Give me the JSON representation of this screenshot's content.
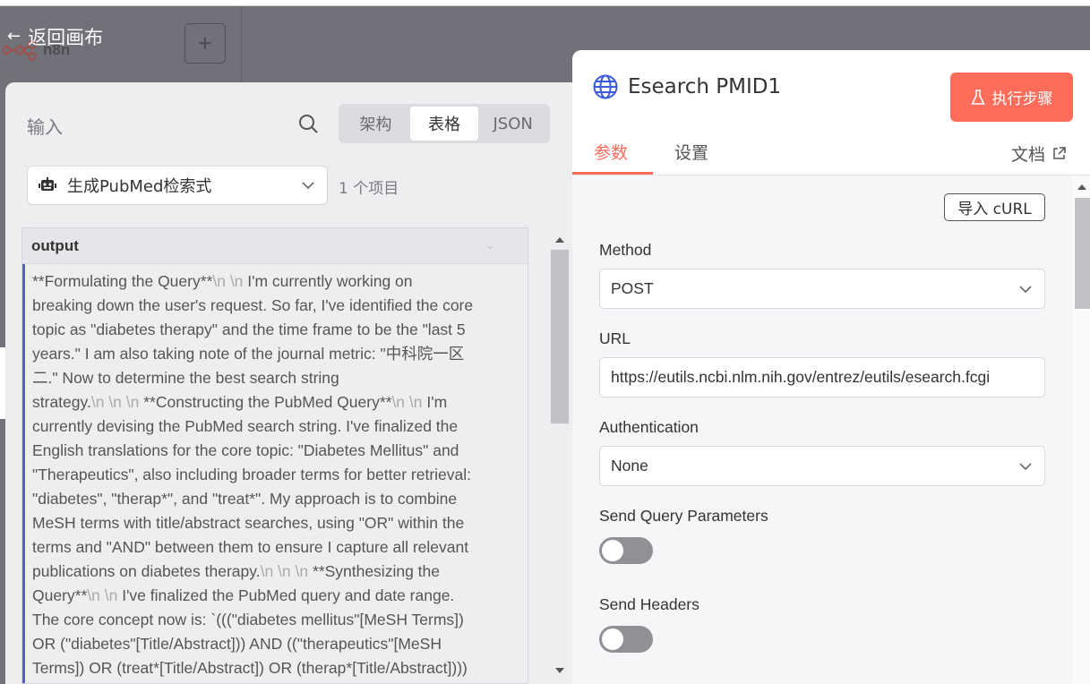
{
  "canvas": {
    "back_label": "返回画布",
    "logo_text": "n8n",
    "add_label": "+"
  },
  "input_panel": {
    "title": "输入",
    "view_tabs": [
      "架构",
      "表格",
      "JSON"
    ],
    "active_view": "表格",
    "source_node": "生成PubMed检索式",
    "item_count": "1 个项目",
    "table": {
      "column": "output",
      "cell_lines": [
        [
          {
            "t": "**Formulating the Query**"
          },
          {
            "t": "\\n \\n ",
            "nl": true
          },
          {
            "t": "I'm currently working on"
          }
        ],
        [
          {
            "t": "breaking down the user's request. So far, I've identified the core"
          }
        ],
        [
          {
            "t": "topic as \"diabetes therapy\" and the time frame to be the \"last 5"
          }
        ],
        [
          {
            "t": "years.\" I am also taking note of the journal metric: \"中科院一区"
          }
        ],
        [
          {
            "t": "二.\" Now to determine the best search string"
          }
        ],
        [
          {
            "t": "strategy."
          },
          {
            "t": "\\n \\n \\n ",
            "nl": true
          },
          {
            "t": "**Constructing the PubMed Query**"
          },
          {
            "t": "\\n \\n ",
            "nl": true
          },
          {
            "t": "I'm"
          }
        ],
        [
          {
            "t": "currently devising the PubMed search string. I've finalized the"
          }
        ],
        [
          {
            "t": "English translations for the core topic: \"Diabetes Mellitus\" and"
          }
        ],
        [
          {
            "t": "\"Therapeutics\", also including broader terms for better retrieval:"
          }
        ],
        [
          {
            "t": "\"diabetes\", \"therap*\", and \"treat*\". My approach is to combine"
          }
        ],
        [
          {
            "t": "MeSH terms with title/abstract searches, using \"OR\" within the"
          }
        ],
        [
          {
            "t": "terms and \"AND\" between them to ensure I capture all relevant"
          }
        ],
        [
          {
            "t": "publications on diabetes therapy."
          },
          {
            "t": "\\n \\n \\n ",
            "nl": true
          },
          {
            "t": "**Synthesizing the"
          }
        ],
        [
          {
            "t": "Query**"
          },
          {
            "t": "\\n \\n ",
            "nl": true
          },
          {
            "t": "I've finalized the PubMed query and date range."
          }
        ],
        [
          {
            "t": "The core concept now is: `(((\"diabetes mellitus\"[MeSH Terms])"
          }
        ],
        [
          {
            "t": "OR (\"diabetes\"[Title/Abstract])) AND ((\"therapeutics\"[MeSH"
          }
        ],
        [
          {
            "t": "Terms]) OR (treat*[Title/Abstract]) OR (therap*[Title/Abstract])))"
          }
        ]
      ]
    }
  },
  "node_panel": {
    "title": "Esearch PMID1",
    "execute_label": "执行步骤",
    "tabs": {
      "params": "参数",
      "settings": "设置"
    },
    "docs_label": "文档",
    "import_curl_label": "导入 cURL",
    "method": {
      "label": "Method",
      "value": "POST"
    },
    "url": {
      "label": "URL",
      "value": "https://eutils.ncbi.nlm.nih.gov/entrez/eutils/esearch.fcgi"
    },
    "authentication": {
      "label": "Authentication",
      "value": "None"
    },
    "send_query": {
      "label": "Send Query Parameters",
      "enabled": false
    },
    "send_headers": {
      "label": "Send Headers",
      "enabled": false
    }
  },
  "colors": {
    "accent": "#ff6d5a",
    "row_marker": "#5c5cc8",
    "globe": "#3b5bdb"
  },
  "icons": [
    "back-arrow-icon",
    "n8n-logo-icon",
    "search-icon",
    "robot-icon",
    "chevron-down-icon",
    "globe-icon",
    "flask-icon",
    "external-link-icon"
  ]
}
